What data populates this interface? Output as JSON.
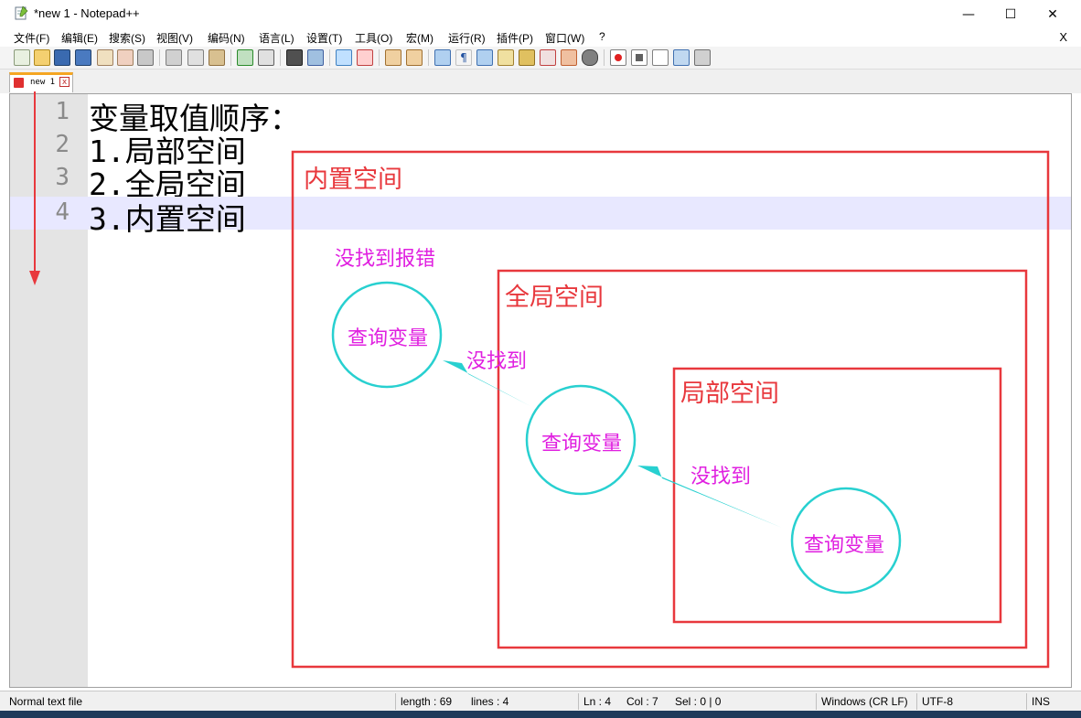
{
  "window": {
    "title": "*new 1 - Notepad++",
    "minimize": "—",
    "maximize": "☐",
    "close": "✕"
  },
  "menu": {
    "items": [
      "文件(F)",
      "编辑(E)",
      "搜索(S)",
      "视图(V)",
      "编码(N)",
      "语言(L)",
      "设置(T)",
      "工具(O)",
      "宏(M)",
      "运行(R)",
      "插件(P)",
      "窗口(W)",
      "?"
    ],
    "close_doc": "X"
  },
  "tab": {
    "label": "new 1",
    "close": "x"
  },
  "editor": {
    "lines": [
      {
        "num": "1",
        "text": "变量取值顺序："
      },
      {
        "num": "2",
        "text": "1.局部空间"
      },
      {
        "num": "3",
        "text": "2.全局空间"
      },
      {
        "num": "4",
        "text": "3.内置空间"
      }
    ]
  },
  "diagram": {
    "builtin_label": "内置空间",
    "global_label": "全局空间",
    "local_label": "局部空间",
    "not_found_error": "没找到报错",
    "not_found_1": "没找到",
    "not_found_2": "没找到",
    "query_1": "查询变量",
    "query_2": "查询变量",
    "query_3": "查询变量",
    "box_color": "#e8383d",
    "circle_color": "#28d0d0",
    "text_color": "#e020e0",
    "arrow_color": "#e8383d"
  },
  "status": {
    "file_type": "Normal text file",
    "length": "length : 69",
    "lines": "lines : 4",
    "ln": "Ln : 4",
    "col": "Col : 7",
    "sel": "Sel : 0 | 0",
    "eol": "Windows (CR LF)",
    "encoding": "UTF-8",
    "ins": "INS"
  }
}
